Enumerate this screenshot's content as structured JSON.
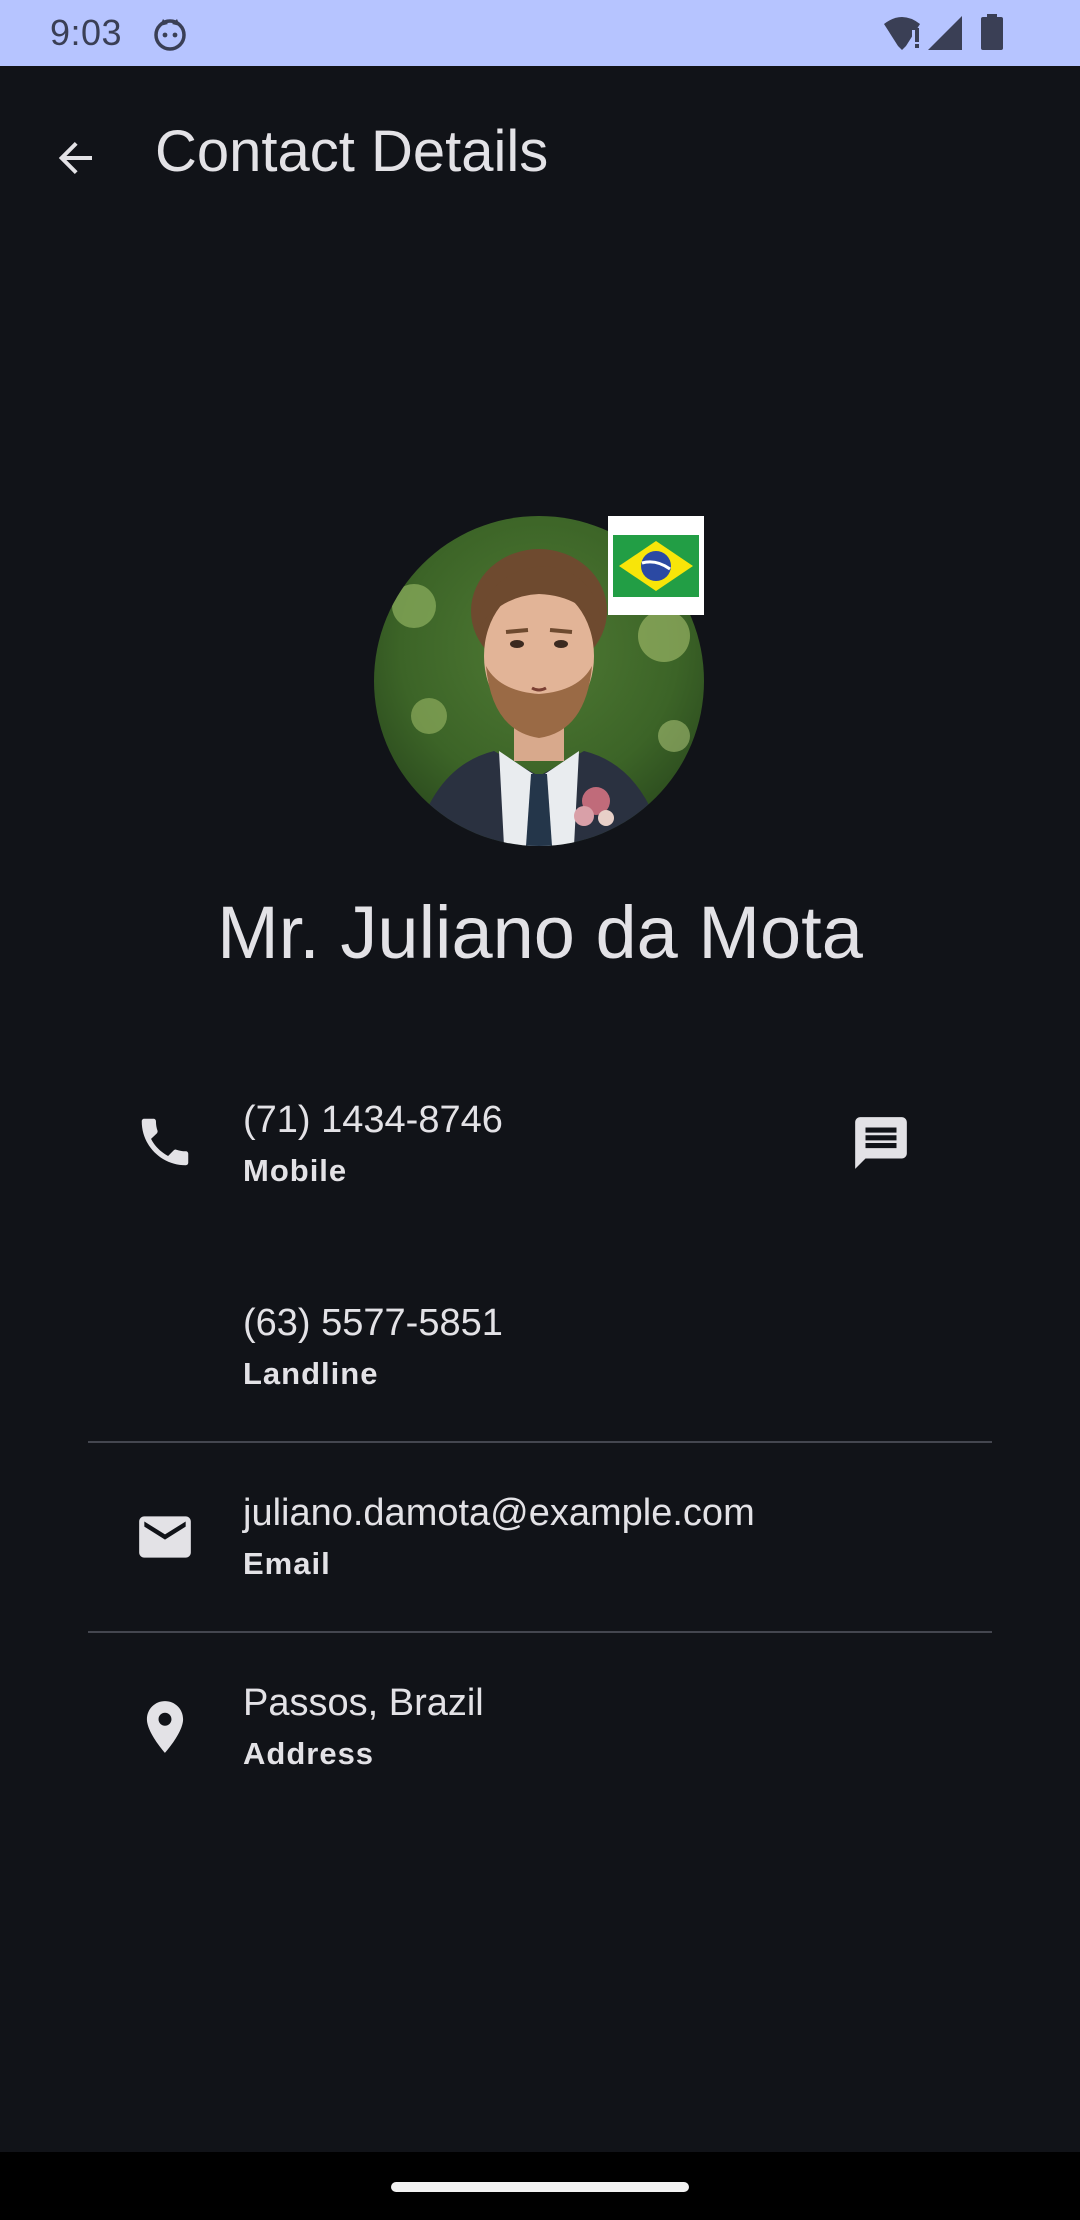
{
  "status_bar": {
    "time": "9:03",
    "icons": [
      "cat-notification-icon",
      "wifi-icon",
      "signal-icon",
      "battery-icon"
    ]
  },
  "app_bar": {
    "title": "Contact Details",
    "back_icon": "arrow-back-icon"
  },
  "contact": {
    "name": "Mr. Juliano da Mota",
    "flag": "brazil-flag-icon"
  },
  "rows": {
    "mobile": {
      "value": "(71) 1434-8746",
      "label": "Mobile",
      "icon": "phone-icon",
      "action_icon": "message-icon"
    },
    "landline": {
      "value": "(63) 5577-5851",
      "label": "Landline"
    },
    "email": {
      "value": "juliano.damota@example.com",
      "label": "Email",
      "icon": "email-icon"
    },
    "address": {
      "value": "Passos, Brazil",
      "label": "Address",
      "icon": "location-pin-icon"
    }
  },
  "colors": {
    "background": "#111318",
    "status_bar": "#b6c4ff",
    "text": "#e3e2e6",
    "divider": "#44464f"
  }
}
